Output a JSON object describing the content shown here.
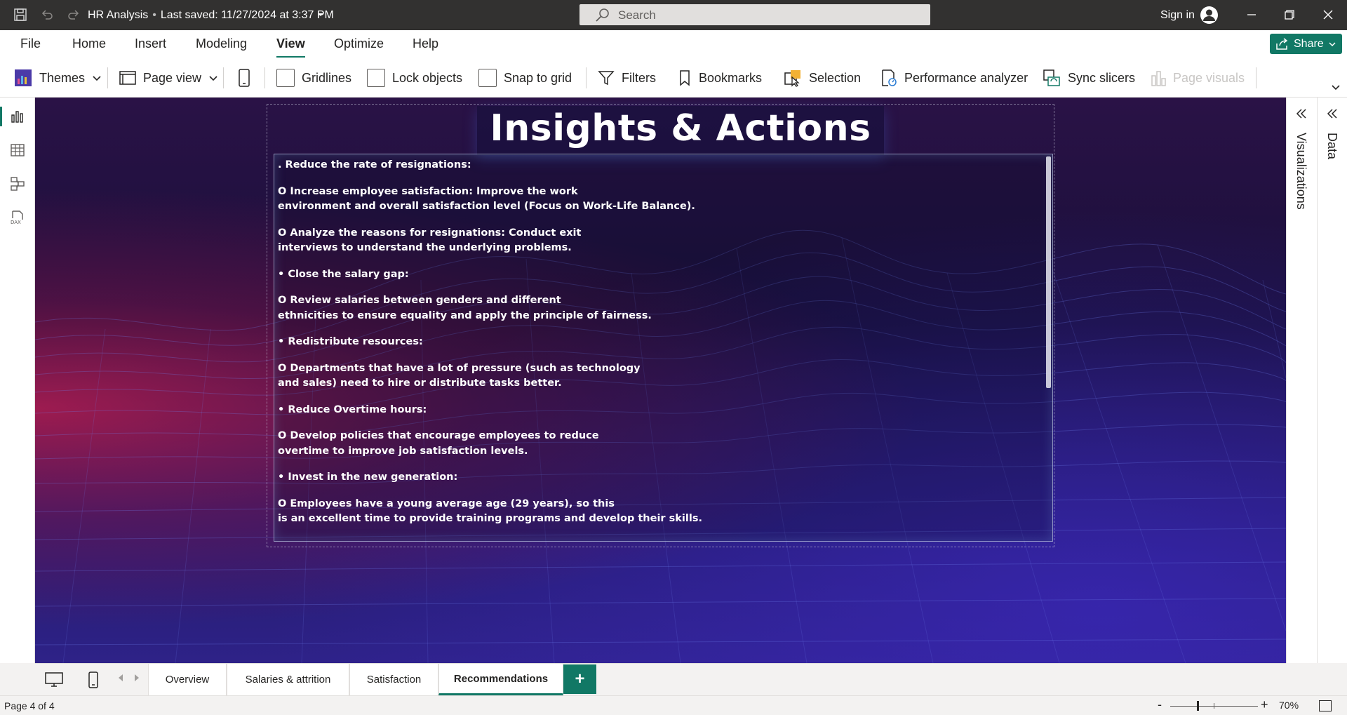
{
  "titlebar": {
    "file_name": "HR Analysis",
    "saved_text": "Last saved: 11/27/2024 at 3:37 PM",
    "search_placeholder": "Search",
    "signin_label": "Sign in"
  },
  "menu": {
    "items": [
      "File",
      "Home",
      "Insert",
      "Modeling",
      "View",
      "Optimize",
      "Help"
    ],
    "active": "View",
    "share_label": "Share"
  },
  "ribbon": {
    "themes": "Themes",
    "page_view": "Page view",
    "gridlines": "Gridlines",
    "lock_objects": "Lock objects",
    "snap_to_grid": "Snap to grid",
    "filters": "Filters",
    "bookmarks": "Bookmarks",
    "selection": "Selection",
    "performance_analyzer": "Performance analyzer",
    "sync_slicers": "Sync slicers",
    "page_visuals": "Page visuals"
  },
  "report": {
    "title": "Insights & Actions",
    "lines": [
      [
        ". Reduce the rate of resignations:"
      ],
      [
        "O Increase employee satisfaction: Improve the work",
        "environment and overall satisfaction level (Focus on Work-Life Balance)."
      ],
      [
        "O Analyze the reasons for resignations: Conduct exit",
        "interviews to understand the underlying problems."
      ],
      [
        "• Close the salary gap:"
      ],
      [
        "O Review salaries between genders and different",
        "ethnicities to ensure equality and apply the principle of fairness."
      ],
      [
        "• Redistribute resources:"
      ],
      [
        "O Departments that have a lot of pressure (such as technology",
        "and sales) need to hire or distribute tasks better."
      ],
      [
        "• Reduce Overtime hours:"
      ],
      [
        "O Develop policies that encourage employees to reduce",
        "overtime to improve job satisfaction levels."
      ],
      [
        "• Invest in the new generation:"
      ],
      [
        "O Employees have a young average age (29 years), so this",
        "is an excellent time to provide training programs and develop their skills."
      ]
    ]
  },
  "panes": {
    "visualizations": "Visualizations",
    "data": "Data"
  },
  "pages": {
    "tabs": [
      "Overview",
      "Salaries & attrition",
      "Satisfaction",
      "Recommendations"
    ],
    "active": "Recommendations",
    "add_label": "+"
  },
  "status": {
    "page_indicator": "Page 4 of 4",
    "zoom_minus": "-",
    "zoom_plus": "+",
    "zoom": "70%"
  },
  "colors": {
    "accent": "#117865",
    "titlebar": "#323130"
  }
}
